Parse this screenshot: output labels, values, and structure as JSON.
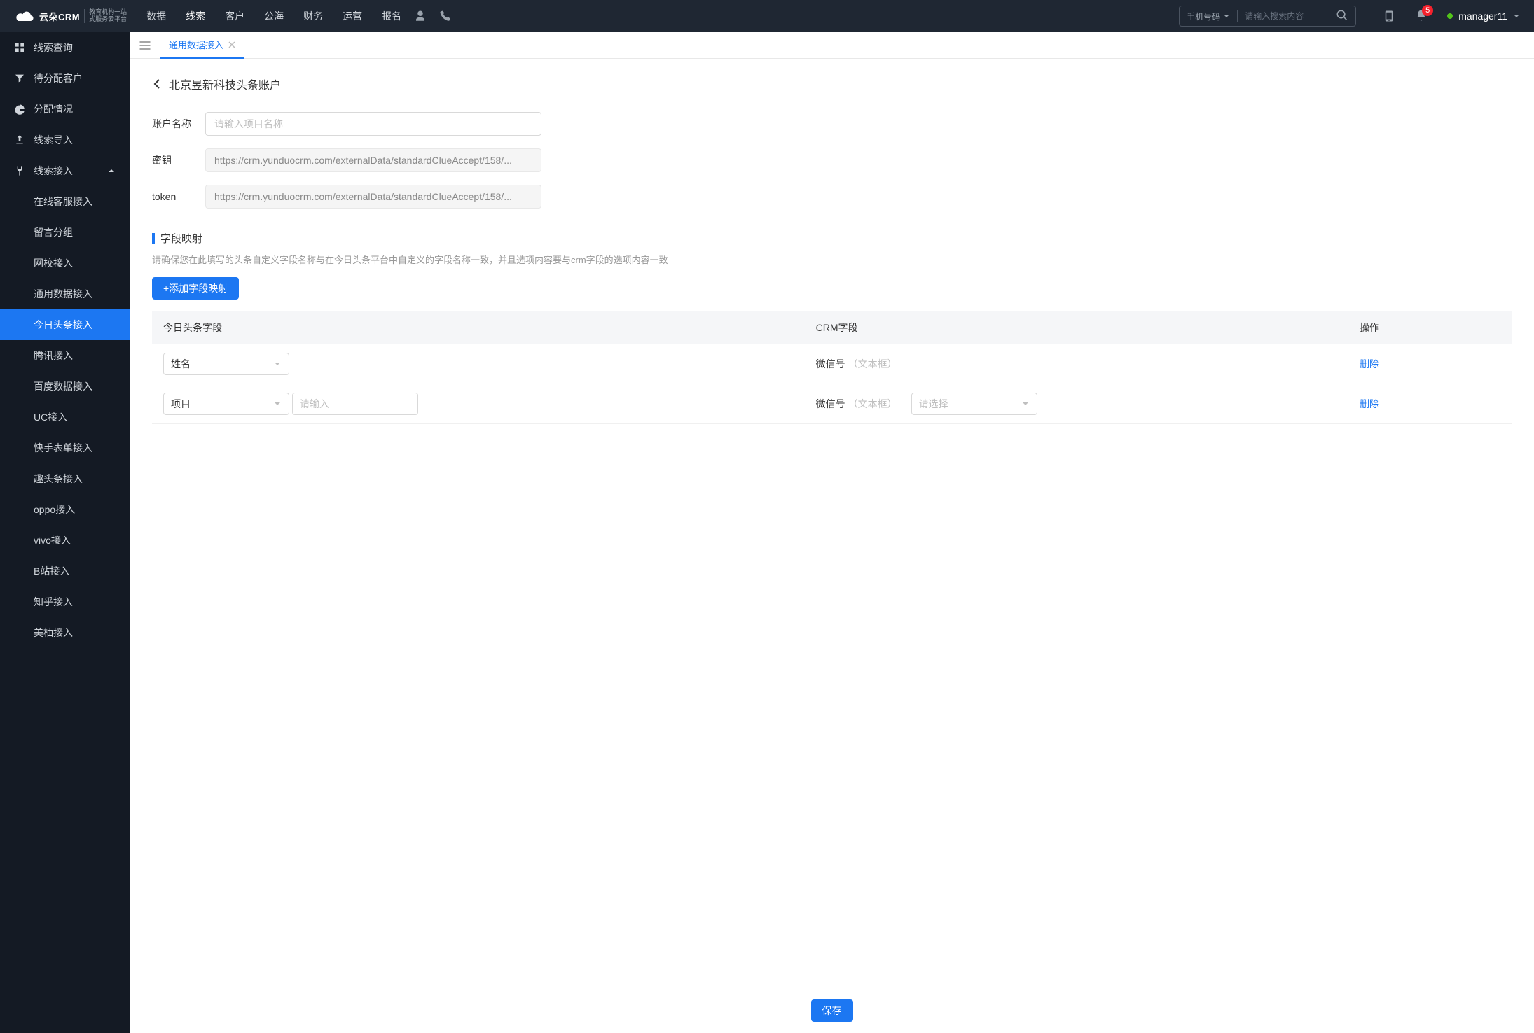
{
  "header": {
    "logo_text": "云朵CRM",
    "logo_sub1": "教育机构一站",
    "logo_sub2": "式服务云平台",
    "nav": [
      "数据",
      "线索",
      "客户",
      "公海",
      "财务",
      "运营",
      "报名"
    ],
    "nav_active": "线索",
    "search_type": "手机号码",
    "search_placeholder": "请输入搜索内容",
    "badge_count": "5",
    "username": "manager11"
  },
  "sidebar": {
    "items": [
      {
        "label": "线索查询",
        "icon": "grid"
      },
      {
        "label": "待分配客户",
        "icon": "filter"
      },
      {
        "label": "分配情况",
        "icon": "pie"
      },
      {
        "label": "线索导入",
        "icon": "export"
      },
      {
        "label": "线索接入",
        "icon": "plug",
        "expanded": true
      }
    ],
    "sub_items": [
      "在线客服接入",
      "留言分组",
      "网校接入",
      "通用数据接入",
      "今日头条接入",
      "腾讯接入",
      "百度数据接入",
      "UC接入",
      "快手表单接入",
      "趣头条接入",
      "oppo接入",
      "vivo接入",
      "B站接入",
      "知乎接入",
      "美柚接入"
    ],
    "sub_active": "今日头条接入"
  },
  "tabs": [
    {
      "label": "通用数据接入",
      "active": true
    }
  ],
  "page": {
    "title": "北京昱新科技头条账户",
    "account_name_label": "账户名称",
    "account_name_placeholder": "请输入项目名称",
    "secret_label": "密钥",
    "secret_value": "https://crm.yunduocrm.com/externalData/standardClueAccept/158/...",
    "token_label": "token",
    "token_value": "https://crm.yunduocrm.com/externalData/standardClueAccept/158/...",
    "mapping_title": "字段映射",
    "mapping_tip": "请确保您在此填写的头条自定义字段名称与在今日头条平台中自定义的字段名称一致，并且选项内容要与crm字段的选项内容一致",
    "add_mapping_btn": "+添加字段映射",
    "table": {
      "headers": [
        "今日头条字段",
        "CRM字段",
        "操作"
      ],
      "rows": [
        {
          "toutiao_field": "姓名",
          "extra_input_placeholder": "",
          "crm_field": "微信号",
          "crm_type": "（文本框）",
          "crm_select_placeholder": "",
          "action": "删除"
        },
        {
          "toutiao_field": "项目",
          "extra_input_placeholder": "请输入",
          "crm_field": "微信号",
          "crm_type": "（文本框）",
          "crm_select_placeholder": "请选择",
          "action": "删除"
        }
      ]
    },
    "save_btn": "保存"
  }
}
